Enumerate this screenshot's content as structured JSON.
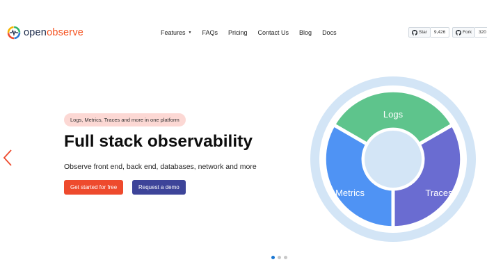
{
  "header": {
    "logo": {
      "part1": "open",
      "part2": "observe"
    },
    "nav": [
      {
        "label": "Features",
        "has_dropdown": true
      },
      {
        "label": "FAQs"
      },
      {
        "label": "Pricing"
      },
      {
        "label": "Contact Us"
      },
      {
        "label": "Blog"
      },
      {
        "label": "Docs"
      }
    ],
    "github": {
      "star_label": "Star",
      "star_count": "9,426",
      "fork_label": "Fork",
      "fork_count": "320"
    }
  },
  "hero": {
    "pill": "Logs, Metrics, Traces and more in one platform",
    "title": "Full stack observability",
    "subtitle": "Observe front end, back end, databases, network and more",
    "primary_cta": "Get started for free",
    "secondary_cta": "Request a demo"
  },
  "wheel": {
    "segments": [
      {
        "label": "Logs",
        "color": "#5ec48c"
      },
      {
        "label": "Traces",
        "color": "#6a6cd1"
      },
      {
        "label": "Metrics",
        "color": "#4f93f4"
      }
    ],
    "ring_color": "#d3e5f6"
  },
  "carousel": {
    "slide_count": 3,
    "active_index": 0
  },
  "colors": {
    "accent": "#ee4a2d",
    "secondary": "#3d4499",
    "pill_bg": "#fcd8d4"
  }
}
